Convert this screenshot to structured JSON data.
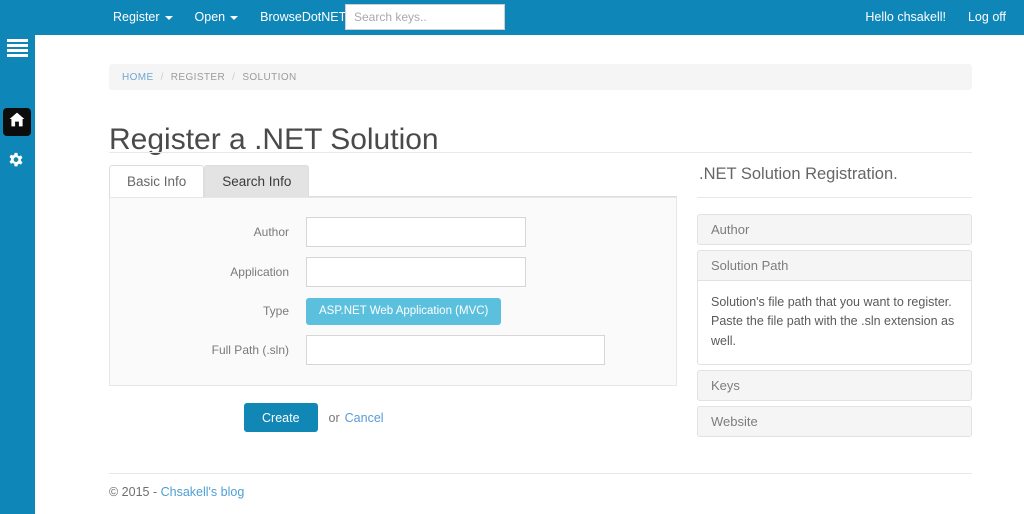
{
  "navbar": {
    "brand_links": [
      {
        "label": "Register",
        "caret": true,
        "icon": "chevron-down-icon"
      },
      {
        "label": "Open",
        "caret": true,
        "icon": "chevron-down-icon"
      },
      {
        "label": "BrowseDotNET",
        "caret": true,
        "icon": "chevron-down-icon"
      }
    ],
    "search": {
      "value": "",
      "placeholder": "Search keys.."
    },
    "right_links": [
      {
        "label": "Hello chsakell!"
      },
      {
        "label": "Log off"
      }
    ],
    "background_color": "#0e87b8"
  },
  "sidebar": {
    "background_color": "#0e87b8",
    "items": [
      {
        "icon": "hamburger-menu-icon",
        "label": ""
      },
      {
        "icon": "home-icon",
        "label": "",
        "active": true
      },
      {
        "icon": "gear-icon",
        "label": ""
      }
    ]
  },
  "breadcrumb": {
    "items": [
      {
        "label": "HOME",
        "active": true
      },
      {
        "label": "REGISTER",
        "active": false
      },
      {
        "label": "SOLUTION",
        "active": false
      }
    ],
    "separator": "/"
  },
  "page": {
    "title": "Register a .NET Solution"
  },
  "tabs": [
    {
      "label": "Basic Info",
      "state": "white"
    },
    {
      "label": "Search Info",
      "state": "grey"
    }
  ],
  "form": {
    "fields": [
      {
        "label": "Author",
        "type": "text",
        "value": "",
        "placeholder": "",
        "width": "narrow"
      },
      {
        "label": "Application",
        "type": "text",
        "value": "",
        "placeholder": "",
        "width": "narrow"
      },
      {
        "label": "Type",
        "type": "badge",
        "value": "ASP.NET Web Application (MVC)",
        "color": "#5bc0de"
      },
      {
        "label": "Full Path (.sln)",
        "type": "text",
        "value": "",
        "placeholder": "",
        "width": "wide"
      }
    ]
  },
  "actions": {
    "create_label": "Create",
    "create_color": "#1087b5",
    "or_text": "or",
    "cancel_label": "Cancel"
  },
  "aside": {
    "title": ".NET Solution Registration.",
    "accordion": [
      {
        "label": "Author",
        "open": false,
        "body": ""
      },
      {
        "label": "Solution Path",
        "open": true,
        "body": "Solution's file path that you want to register. Paste the file path with the .sln extension as well."
      },
      {
        "label": "Keys",
        "open": false,
        "body": ""
      },
      {
        "label": "Website",
        "open": false,
        "body": ""
      }
    ]
  },
  "footer": {
    "copyright": "© 2015 - ",
    "link_label": "Chsakell's blog"
  }
}
